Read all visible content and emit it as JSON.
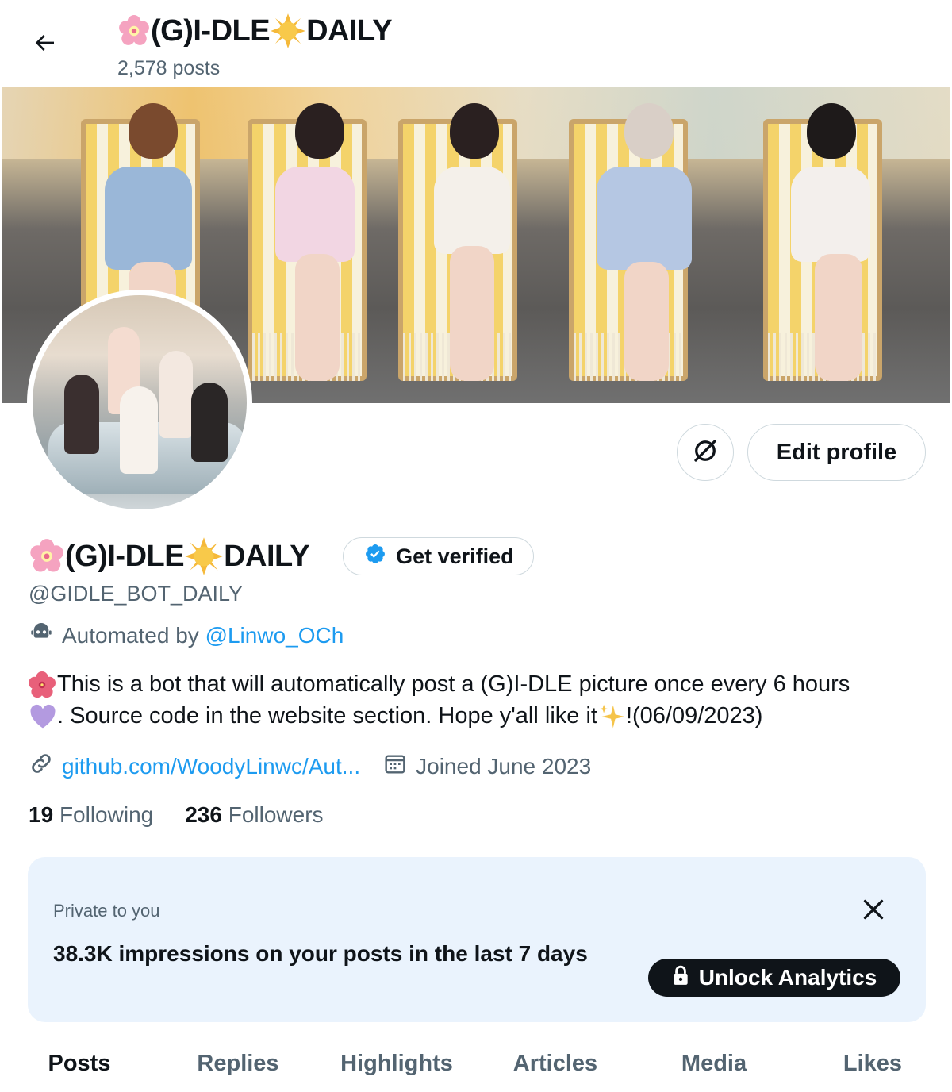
{
  "header": {
    "name_part1": "(G)I-DLE",
    "name_part2": "DAILY",
    "posts_count": "2,578 posts"
  },
  "profile": {
    "name_part1": "(G)I-DLE",
    "name_part2": "DAILY",
    "get_verified_label": "Get verified",
    "handle": "@GIDLE_BOT_DAILY",
    "automated_prefix": "Automated by",
    "automated_link": "@Linwo_OCh",
    "bio_line1": "This is a bot that will automatically post a (G)I-DLE picture once every 6 hours",
    "bio_line2a": ". Source code in the website section. Hope y'all like it",
    "bio_line2b": "!(06/09/2023)",
    "website": "github.com/WoodyLinwc/Aut...",
    "joined": "Joined June 2023",
    "following_count": "19",
    "following_label": "Following",
    "followers_count": "236",
    "followers_label": "Followers",
    "edit_profile_label": "Edit profile"
  },
  "analytics_card": {
    "private_label": "Private to you",
    "impressions_text": "38.3K impressions on your posts in the last 7 days",
    "unlock_label": "Unlock Analytics"
  },
  "tabs": [
    {
      "label": "Posts",
      "active": true
    },
    {
      "label": "Replies",
      "active": false
    },
    {
      "label": "Highlights",
      "active": false
    },
    {
      "label": "Articles",
      "active": false
    },
    {
      "label": "Media",
      "active": false
    },
    {
      "label": "Likes",
      "active": false
    }
  ],
  "icons": {
    "back": "arrow-left-icon",
    "emoji_1": "cherry-blossom-emoji",
    "emoji_2": "sun-emoji",
    "bot": "robot-icon",
    "link": "link-icon",
    "calendar": "calendar-icon",
    "grok": "slashed-circle-icon",
    "verified": "verified-badge-icon",
    "close": "close-icon",
    "lock": "lock-icon",
    "heart": "purple-heart-emoji",
    "sparkles": "sparkles-emoji",
    "hibiscus": "hibiscus-emoji"
  },
  "colors": {
    "accent": "#1d9bf0",
    "text_primary": "#0f1419",
    "text_secondary": "#536471",
    "card_bg": "#eaf3fd"
  }
}
